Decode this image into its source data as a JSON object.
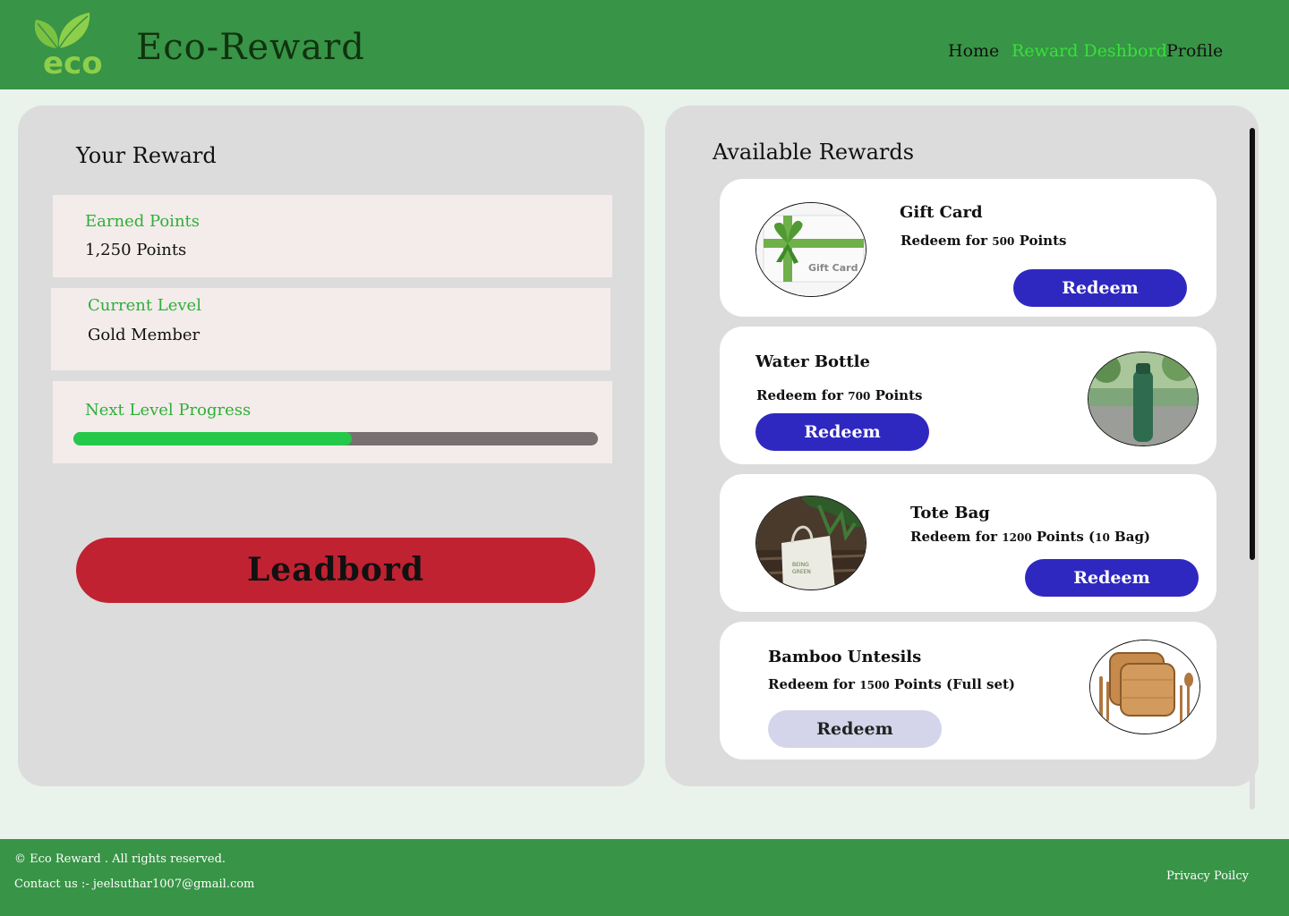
{
  "colors": {
    "header_bg": "#389446",
    "accent_green": "#39e03c",
    "label_green": "#2fae38",
    "redeem_blue": "#2f28c0",
    "leaderboard_red": "#c02231",
    "progress_fill": "#24c94a"
  },
  "header": {
    "logo_text": "eco",
    "brand": "Eco-Reward",
    "nav": [
      "Home",
      "Reward Deshbord",
      "Profile"
    ],
    "active_nav": "Reward Deshbord"
  },
  "left": {
    "title": "Your Reward",
    "earned": {
      "label": "Earned Points",
      "value": "1,250 Points"
    },
    "level": {
      "label": "Current Level",
      "value": "Gold Member"
    },
    "progress": {
      "label": "Next Level Progress",
      "fraction": 0.53
    },
    "leaderboard_label": "Leadbord"
  },
  "right": {
    "title": "Available Rewards",
    "rewards": [
      {
        "title": "Gift Card",
        "cost_prefix": "Redeem for",
        "cost_num": "500",
        "cost_suffix": "Points",
        "button": "Redeem",
        "enabled": true,
        "image": "gift-card",
        "image_text": "Gift Card"
      },
      {
        "title": "Water Bottle",
        "cost_prefix": "Redeem for",
        "cost_num": "700",
        "cost_suffix": "Points",
        "button": "Redeem",
        "enabled": true,
        "image": "water-bottle"
      },
      {
        "title": "Tote Bag",
        "cost_prefix": "Redeem for",
        "cost_num": "1200",
        "cost_suffix": "Points (",
        "cost_num2": "10",
        "cost_suffix2": "Bag)",
        "button": "Redeem",
        "enabled": true,
        "image": "tote-bag"
      },
      {
        "title": "Bamboo Untesils",
        "cost_prefix": "Redeem for",
        "cost_num": "1500",
        "cost_suffix": "Points (Full set)",
        "button": "Redeem",
        "enabled": false,
        "image": "bamboo-utensils"
      }
    ]
  },
  "footer": {
    "copyright": "© Eco Reward . All rights reserved.",
    "contact": "Contact us :- jeelsuthar1007@gmail.com",
    "privacy": "Privacy Poilcy"
  }
}
